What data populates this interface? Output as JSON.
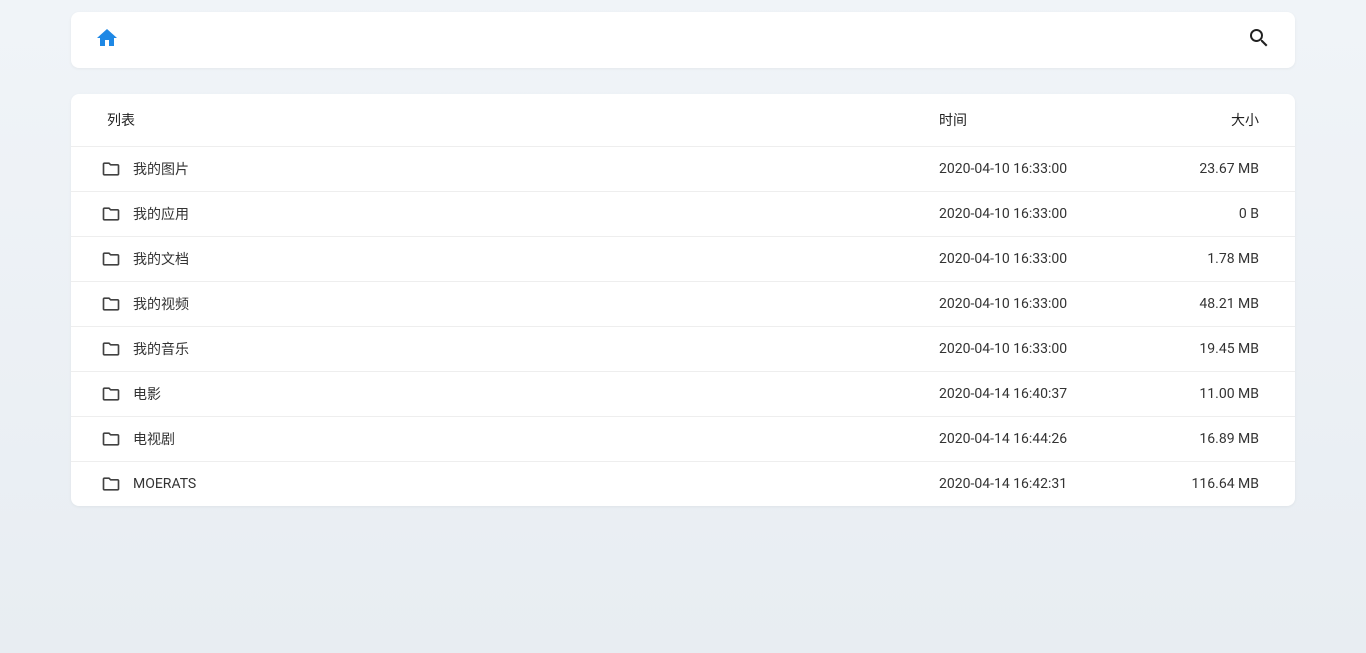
{
  "headers": {
    "name": "列表",
    "time": "时间",
    "size": "大小"
  },
  "files": [
    {
      "name": "我的图片",
      "time": "2020-04-10 16:33:00",
      "size": "23.67 MB"
    },
    {
      "name": "我的应用",
      "time": "2020-04-10 16:33:00",
      "size": "0 B"
    },
    {
      "name": "我的文档",
      "time": "2020-04-10 16:33:00",
      "size": "1.78 MB"
    },
    {
      "name": "我的视频",
      "time": "2020-04-10 16:33:00",
      "size": "48.21 MB"
    },
    {
      "name": "我的音乐",
      "time": "2020-04-10 16:33:00",
      "size": "19.45 MB"
    },
    {
      "name": "电影",
      "time": "2020-04-14 16:40:37",
      "size": "11.00 MB"
    },
    {
      "name": "电视剧",
      "time": "2020-04-14 16:44:26",
      "size": "16.89 MB"
    },
    {
      "name": "MOERATS",
      "time": "2020-04-14 16:42:31",
      "size": "116.64 MB"
    }
  ]
}
